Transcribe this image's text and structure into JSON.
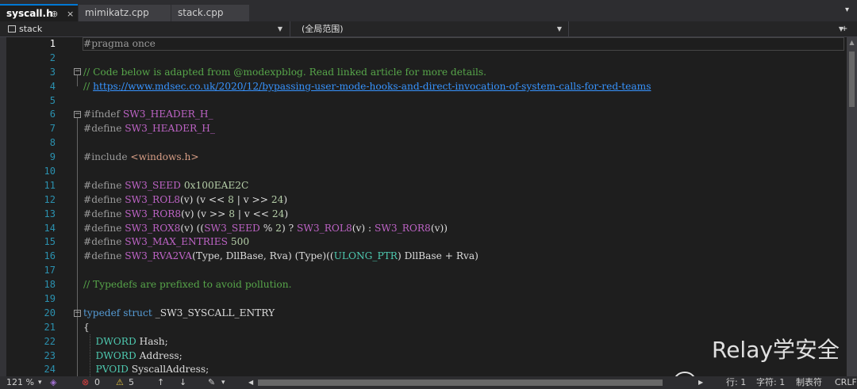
{
  "tabs": [
    {
      "label": "syscall.h",
      "pin": "⊕",
      "close": "×",
      "active": true
    },
    {
      "label": "mimikatz.cpp",
      "active": false
    },
    {
      "label": "stack.cpp",
      "active": false
    }
  ],
  "navbar": {
    "project": "stack",
    "scope": "(全局范围)",
    "member": ""
  },
  "editor": {
    "line_numbers": [
      "1",
      "2",
      "3",
      "4",
      "5",
      "6",
      "7",
      "8",
      "9",
      "10",
      "11",
      "12",
      "13",
      "14",
      "15",
      "16",
      "17",
      "18",
      "19",
      "20",
      "21",
      "22",
      "23",
      "24"
    ],
    "lines": [
      "#pragma once",
      "",
      "// Code below is adapted from @modexpblog. Read linked article for more details.",
      "// https://www.mdsec.co.uk/2020/12/bypassing-user-mode-hooks-and-direct-invocation-of-system-calls-for-red-teams",
      "",
      "#ifndef SW3_HEADER_H_",
      "#define SW3_HEADER_H_",
      "",
      "#include <windows.h>",
      "",
      "#define SW3_SEED 0x100EAE2C",
      "#define SW3_ROL8(v) (v << 8 | v >> 24)",
      "#define SW3_ROR8(v) (v >> 8 | v << 24)",
      "#define SW3_ROX8(v) ((SW3_SEED % 2) ? SW3_ROL8(v) : SW3_ROR8(v))",
      "#define SW3_MAX_ENTRIES 500",
      "#define SW3_RVA2VA(Type, DllBase, Rva) (Type)((ULONG_PTR) DllBase + Rva)",
      "",
      "// Typedefs are prefixed to avoid pollution.",
      "",
      "typedef struct _SW3_SYSCALL_ENTRY",
      "{",
      "    DWORD Hash;",
      "    DWORD Address;",
      "    PVOID SyscallAddress;"
    ]
  },
  "status": {
    "zoom": "121 %",
    "errors": "0",
    "warnings": "5",
    "line": "行: 1",
    "char": "字符: 1",
    "tabs_mode": "制表符",
    "eol": "CRLF"
  },
  "watermark": "Relay学安全",
  "colors": {
    "accent": "#0078d4",
    "comment": "#57a64a",
    "keyword": "#569cd6",
    "macro": "#bd63c5",
    "line_number": "#2b91af"
  }
}
